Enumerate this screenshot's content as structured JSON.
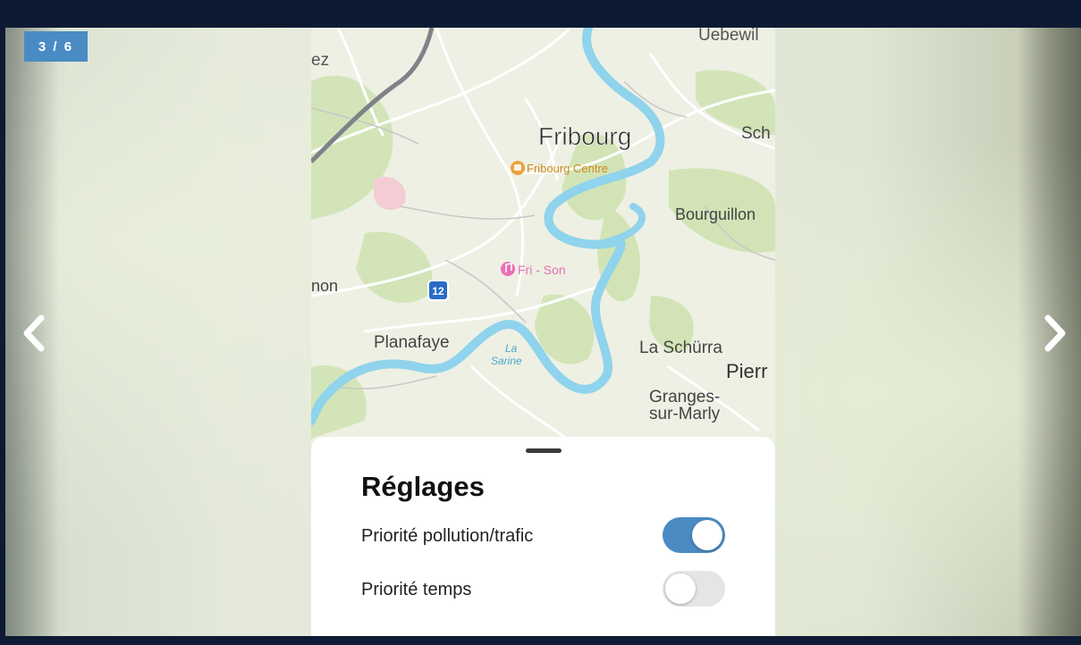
{
  "slideshow": {
    "counter": "3 / 6"
  },
  "map": {
    "labels": {
      "uebewil": "Uebewil",
      "ez": "ez",
      "fribourg": "Fribourg",
      "sch": "Sch",
      "fribourg_centre": "Fribourg Centre",
      "bourguillon": "Bourguillon",
      "fri_son": "Fri - Son",
      "non": "non",
      "route_number": "12",
      "planafaye": "Planafaye",
      "la": "La",
      "sarine": "Sarine",
      "la_schurra": "La Schürra",
      "pierr": "Pierr",
      "granges": "Granges-",
      "sur_marly": "sur-Marly"
    }
  },
  "settings": {
    "title": "Réglages",
    "rows": [
      {
        "label": "Priorité pollution/trafic",
        "enabled": true
      },
      {
        "label": "Priorité temps",
        "enabled": false
      }
    ]
  },
  "colors": {
    "accent": "#4a8bc4",
    "frame": "#0e1a33",
    "river": "#8fd3ec",
    "poi_orange": "#e8a33a",
    "poi_pink": "#e96fb7"
  },
  "icons": {
    "prev": "chevron-left-icon",
    "next": "chevron-right-icon",
    "centre_poi": "shopping-icon",
    "music_poi": "music-note-icon",
    "route_shield": "route-shield-icon"
  }
}
